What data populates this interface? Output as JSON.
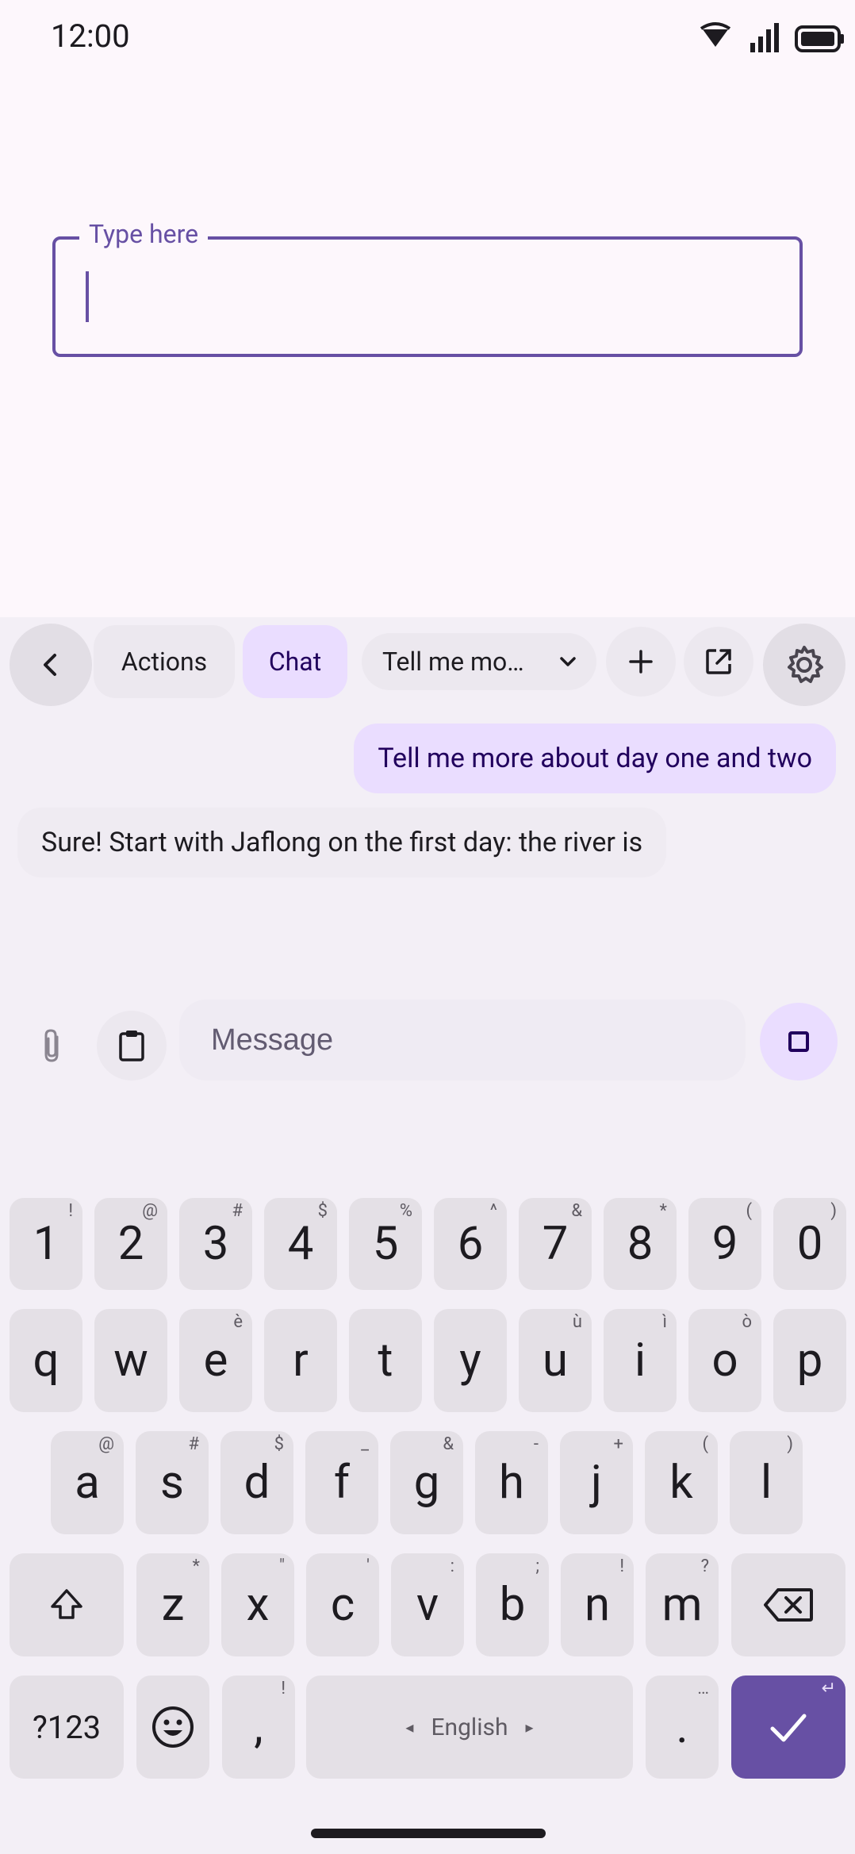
{
  "status_bar": {
    "time": "12:00"
  },
  "text_field": {
    "label": "Type here",
    "value": ""
  },
  "toolbar": {
    "actions_label": "Actions",
    "chat_label": "Chat",
    "prompt_label": "Tell me mo…"
  },
  "chat": {
    "user_message": "Tell me more about day one and two",
    "bot_message": "Sure! Start with Jaflong on the first day: the river is"
  },
  "composer": {
    "placeholder": "Message"
  },
  "keyboard": {
    "row_numbers": [
      {
        "label": "1",
        "hint": "!"
      },
      {
        "label": "2",
        "hint": "@"
      },
      {
        "label": "3",
        "hint": "#"
      },
      {
        "label": "4",
        "hint": "$"
      },
      {
        "label": "5",
        "hint": "%"
      },
      {
        "label": "6",
        "hint": "^"
      },
      {
        "label": "7",
        "hint": "&"
      },
      {
        "label": "8",
        "hint": "*"
      },
      {
        "label": "9",
        "hint": "("
      },
      {
        "label": "0",
        "hint": ")"
      }
    ],
    "row_top": [
      {
        "label": "q",
        "hint": ""
      },
      {
        "label": "w",
        "hint": ""
      },
      {
        "label": "e",
        "hint": "è"
      },
      {
        "label": "r",
        "hint": ""
      },
      {
        "label": "t",
        "hint": ""
      },
      {
        "label": "y",
        "hint": ""
      },
      {
        "label": "u",
        "hint": "ù"
      },
      {
        "label": "i",
        "hint": "ì"
      },
      {
        "label": "o",
        "hint": "ò"
      },
      {
        "label": "p",
        "hint": ""
      }
    ],
    "row_middle": [
      {
        "label": "a",
        "hint": "@"
      },
      {
        "label": "s",
        "hint": "#"
      },
      {
        "label": "d",
        "hint": "$"
      },
      {
        "label": "f",
        "hint": "_"
      },
      {
        "label": "g",
        "hint": "&"
      },
      {
        "label": "h",
        "hint": "-"
      },
      {
        "label": "j",
        "hint": "+"
      },
      {
        "label": "k",
        "hint": "("
      },
      {
        "label": "l",
        "hint": ")"
      }
    ],
    "row_bottom": [
      {
        "label": "z",
        "hint": "*"
      },
      {
        "label": "x",
        "hint": "\""
      },
      {
        "label": "c",
        "hint": "'"
      },
      {
        "label": "v",
        "hint": ":"
      },
      {
        "label": "b",
        "hint": ";"
      },
      {
        "label": "n",
        "hint": "!"
      },
      {
        "label": "m",
        "hint": "?"
      }
    ],
    "symbols_label": "?123",
    "comma_label": ",",
    "comma_hint": "!",
    "space_label": "English",
    "period_label": ".",
    "period_hint": "…",
    "enter_hint": "↵"
  },
  "colors": {
    "accent": "#6750a4",
    "chip_selected": "#eaddff",
    "background": "#fdf7fc",
    "panel": "#f3eff6"
  }
}
